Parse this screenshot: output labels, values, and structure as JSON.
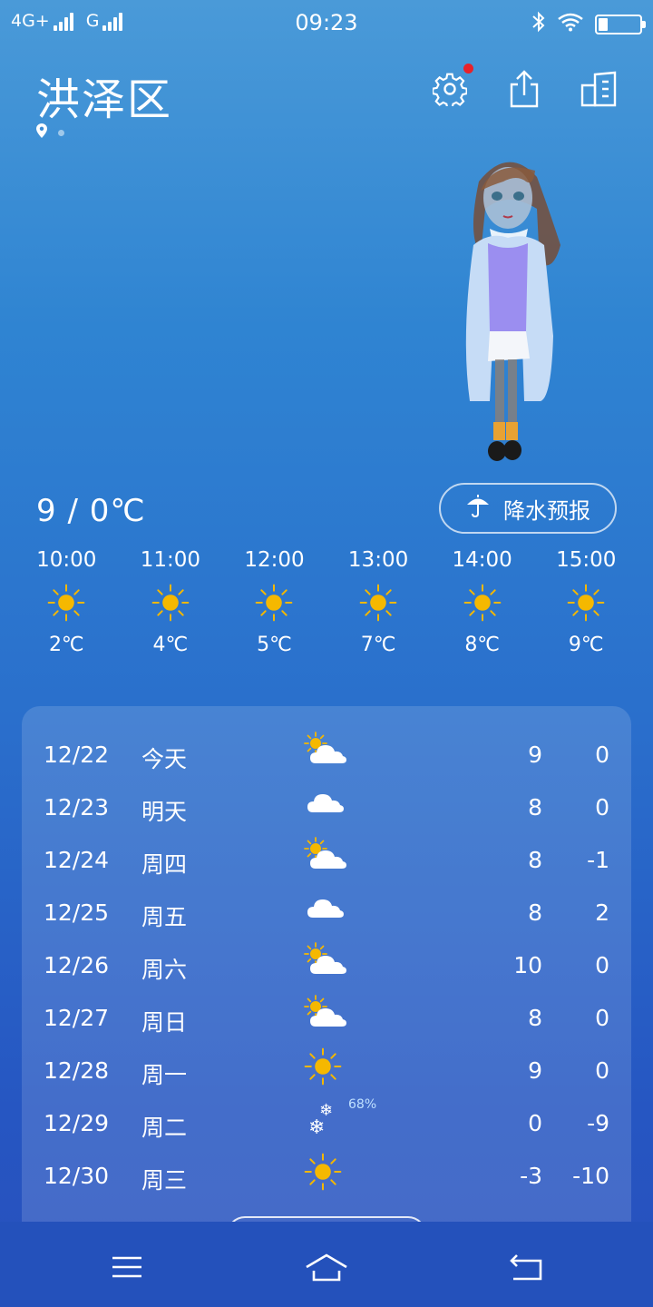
{
  "status_bar": {
    "network1": "4G+",
    "network2": "G",
    "time": "09:23"
  },
  "header": {
    "city": "洪泽区",
    "icons": [
      "settings-icon",
      "share-icon",
      "city-list-icon"
    ],
    "settings_badge_color": "#e8222a"
  },
  "today": {
    "temp_range": "9 / 0℃",
    "precip_button_label": "降水预报"
  },
  "hourly": [
    {
      "time": "10:00",
      "icon": "sunny-icon",
      "temp": "2℃"
    },
    {
      "time": "11:00",
      "icon": "sunny-icon",
      "temp": "4℃"
    },
    {
      "time": "12:00",
      "icon": "sunny-icon",
      "temp": "5℃"
    },
    {
      "time": "13:00",
      "icon": "sunny-icon",
      "temp": "7℃"
    },
    {
      "time": "14:00",
      "icon": "sunny-icon",
      "temp": "8℃"
    },
    {
      "time": "15:00",
      "icon": "sunny-icon",
      "temp": "9℃"
    }
  ],
  "daily": [
    {
      "date": "12/22",
      "day": "今天",
      "icon": "partly-cloudy",
      "high": "9",
      "low": "0",
      "pct": ""
    },
    {
      "date": "12/23",
      "day": "明天",
      "icon": "cloudy",
      "high": "8",
      "low": "0",
      "pct": ""
    },
    {
      "date": "12/24",
      "day": "周四",
      "icon": "partly-cloudy",
      "high": "8",
      "low": "-1",
      "pct": ""
    },
    {
      "date": "12/25",
      "day": "周五",
      "icon": "cloudy",
      "high": "8",
      "low": "2",
      "pct": ""
    },
    {
      "date": "12/26",
      "day": "周六",
      "icon": "partly-cloudy",
      "high": "10",
      "low": "0",
      "pct": ""
    },
    {
      "date": "12/27",
      "day": "周日",
      "icon": "partly-cloudy",
      "high": "8",
      "low": "0",
      "pct": ""
    },
    {
      "date": "12/28",
      "day": "周一",
      "icon": "sunny",
      "high": "9",
      "low": "0",
      "pct": ""
    },
    {
      "date": "12/29",
      "day": "周二",
      "icon": "snow",
      "high": "0",
      "low": "-9",
      "pct": "68%"
    },
    {
      "date": "12/30",
      "day": "周三",
      "icon": "sunny",
      "high": "-3",
      "low": "-10",
      "pct": ""
    }
  ],
  "colors": {
    "sun": "#f5b800",
    "cloud": "#ffffff"
  }
}
